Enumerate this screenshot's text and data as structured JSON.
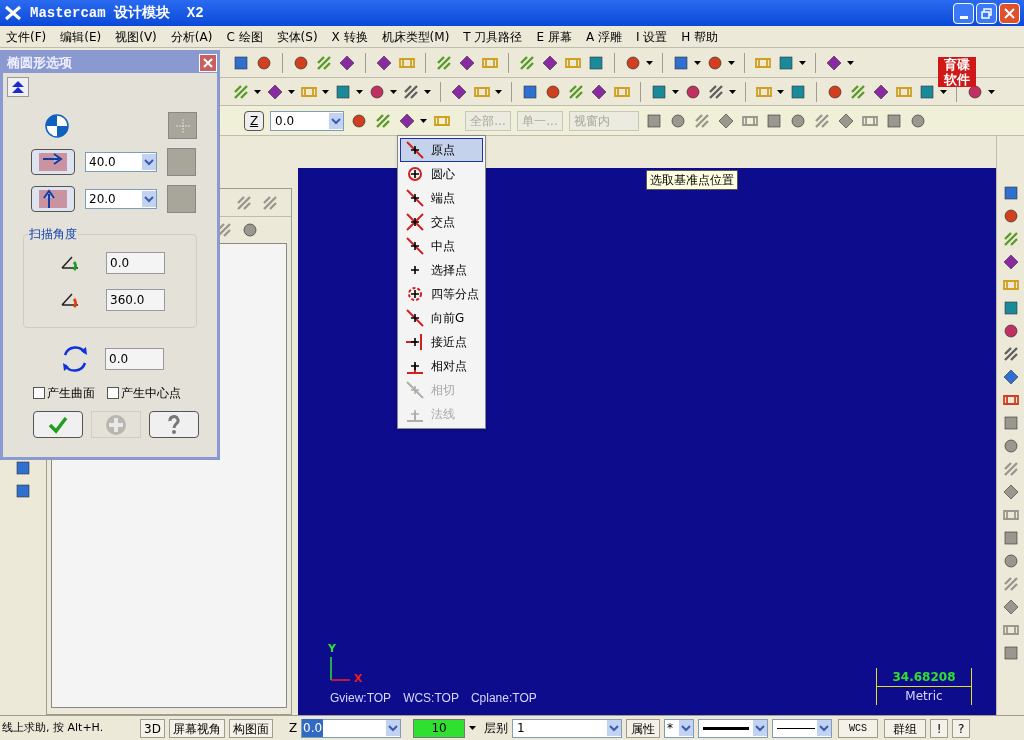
{
  "window": {
    "title": "Mastercam 设计模块  X2"
  },
  "menu_bar": [
    {
      "label": "文件(F)"
    },
    {
      "label": "编辑(E)"
    },
    {
      "label": "视图(V)"
    },
    {
      "label": "分析(A)"
    },
    {
      "label": "C 绘图"
    },
    {
      "label": "实体(S)"
    },
    {
      "label": "X 转换"
    },
    {
      "label": "机床类型(M)"
    },
    {
      "label": "T 刀具路径"
    },
    {
      "label": "E 屏幕"
    },
    {
      "label": "A 浮雕"
    },
    {
      "label": "I 设置"
    },
    {
      "label": "H 帮助"
    }
  ],
  "logo": {
    "line1": "育碟",
    "line2": "软件"
  },
  "ribbon": {
    "z_button": "Z",
    "z_value": "0.0",
    "buttons": [
      "全部...",
      "单一..."
    ],
    "window_select": "视窗内"
  },
  "dialog": {
    "title": "椭圆形选项",
    "width_value": "40.0",
    "height_value": "20.0",
    "sweep_group": "扫描角度",
    "start_angle": "0.0",
    "end_angle": "360.0",
    "rotation": "0.0",
    "checkboxes": [
      {
        "label": "产生曲面",
        "checked": false
      },
      {
        "label": "产生中心点",
        "checked": false
      }
    ]
  },
  "snap_menu": {
    "items": [
      {
        "label": "原点",
        "selected": true,
        "disabled": false
      },
      {
        "label": "圆心",
        "selected": false,
        "disabled": false
      },
      {
        "label": "端点",
        "selected": false,
        "disabled": false
      },
      {
        "label": "交点",
        "selected": false,
        "disabled": false
      },
      {
        "label": "中点",
        "selected": false,
        "disabled": false
      },
      {
        "label": "选择点",
        "selected": false,
        "disabled": false
      },
      {
        "label": "四等分点",
        "selected": false,
        "disabled": false
      },
      {
        "label": "向前G",
        "selected": false,
        "disabled": false
      },
      {
        "label": "接近点",
        "selected": false,
        "disabled": false
      },
      {
        "label": "相对点",
        "selected": false,
        "disabled": false
      },
      {
        "label": "相切",
        "selected": false,
        "disabled": true
      },
      {
        "label": "法线",
        "selected": false,
        "disabled": true
      }
    ]
  },
  "tooltip": "选取基准点位置",
  "canvas": {
    "axis_y": "Y",
    "axis_x": "X",
    "view_info": [
      "Gview:TOP",
      "WCS:TOP",
      "Cplane:TOP"
    ],
    "scale_value": "34.68208",
    "scale_unit": "Metric"
  },
  "status_bar": {
    "hint": "线上求助, 按 Alt+H.",
    "buttons": [
      "3D",
      "屏幕视角",
      "构图面"
    ],
    "z_label": "Z",
    "z_value": "0.0",
    "color_value": "10",
    "level_label": "层别",
    "level_value": "1",
    "attr_button": "属性",
    "point_style": "*",
    "wcs_button": "WCS",
    "group_button": "群组",
    "bang_button": "!",
    "help_button": "?"
  }
}
